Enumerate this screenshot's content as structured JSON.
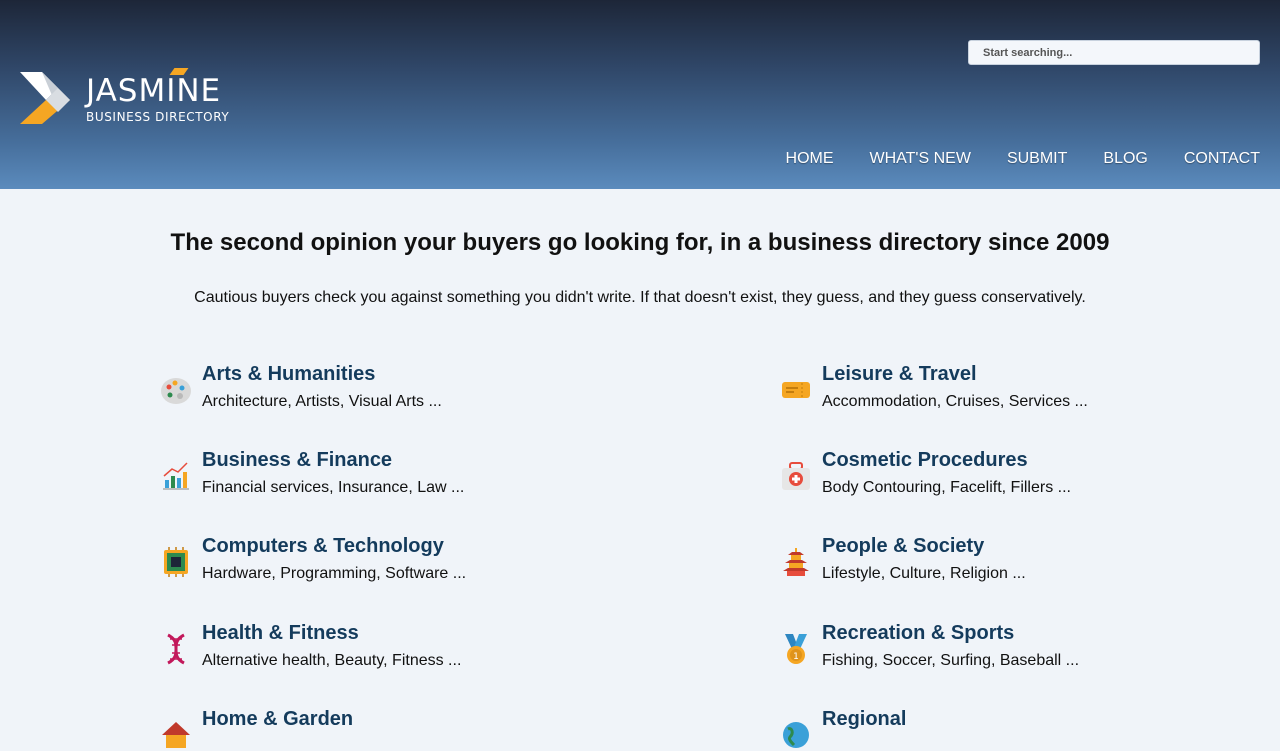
{
  "brand": {
    "name": "JASMINE",
    "tagline": "BUSINESS DIRECTORY"
  },
  "search": {
    "placeholder": "Start searching..."
  },
  "nav": [
    "HOME",
    "WHAT'S NEW",
    "SUBMIT",
    "BLOG",
    "CONTACT"
  ],
  "hero": {
    "title": "The second opinion your buyers go looking for, in a business directory since 2009",
    "subtitle": "Cautious buyers check you against something you didn't write. If that doesn't exist, they guess, and they guess conservatively."
  },
  "categories": [
    {
      "title": "Arts & Humanities",
      "subs": "Architecture, Artists, Visual Arts ...",
      "icon": "palette-icon"
    },
    {
      "title": "Leisure & Travel",
      "subs": "Accommodation, Cruises, Services ...",
      "icon": "ticket-icon"
    },
    {
      "title": "Business & Finance",
      "subs": "Financial services, Insurance, Law ...",
      "icon": "growth-chart-icon"
    },
    {
      "title": "Cosmetic Procedures",
      "subs": "Body Contouring, Facelift, Fillers ...",
      "icon": "first-aid-kit-icon"
    },
    {
      "title": "Computers & Technology",
      "subs": "Hardware, Programming, Software ...",
      "icon": "cpu-chip-icon"
    },
    {
      "title": "People & Society",
      "subs": "Lifestyle, Culture, Religion ...",
      "icon": "pagoda-icon"
    },
    {
      "title": "Health & Fitness",
      "subs": "Alternative health, Beauty, Fitness ...",
      "icon": "dna-icon"
    },
    {
      "title": "Recreation & Sports",
      "subs": "Fishing, Soccer, Surfing, Baseball ...",
      "icon": "medal-icon"
    },
    {
      "title": "Home & Garden",
      "subs": "",
      "icon": "house-icon"
    },
    {
      "title": "Regional",
      "subs": "",
      "icon": "globe-icon"
    }
  ],
  "colors": {
    "accent": "#f5a623",
    "link": "#143b5c",
    "header_top": "#1d2638",
    "header_bottom": "#5b8bbd"
  }
}
